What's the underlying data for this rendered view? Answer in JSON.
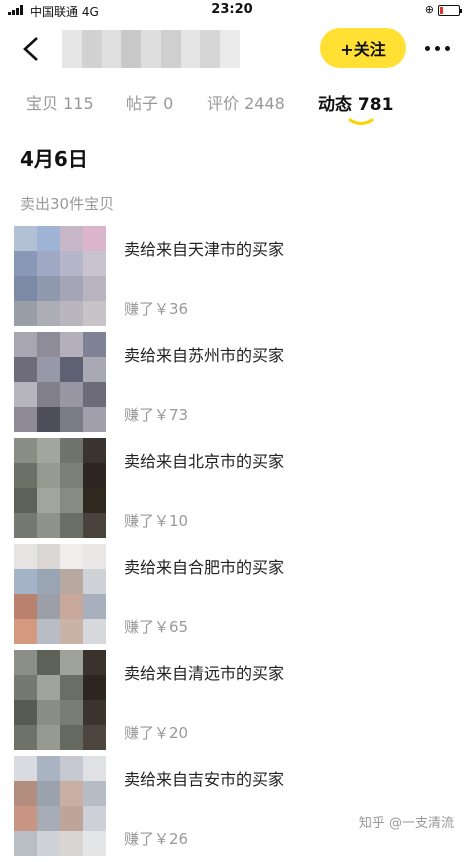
{
  "status_bar": {
    "carrier": "中国联通  4G",
    "time": "23:20",
    "lock_symbol": "⊕"
  },
  "header": {
    "follow_label": "+关注"
  },
  "tabs": [
    {
      "label": "宝贝 115"
    },
    {
      "label": "帖子 0"
    },
    {
      "label": "评价 2448"
    },
    {
      "label": "动态 781",
      "active": true
    }
  ],
  "feed": {
    "date": "4月6日",
    "subtitle": "卖出30件宝贝",
    "items": [
      {
        "desc": "卖给来自天津市的买家",
        "earn": "赚了￥36"
      },
      {
        "desc": "卖给来自苏州市的买家",
        "earn": "赚了￥73"
      },
      {
        "desc": "卖给来自北京市的买家",
        "earn": "赚了￥10"
      },
      {
        "desc": "卖给来自合肥市的买家",
        "earn": "赚了￥65"
      },
      {
        "desc": "卖给来自清远市的买家",
        "earn": "赚了￥20"
      },
      {
        "desc": "卖给来自吉安市的买家",
        "earn": "赚了￥26"
      }
    ]
  },
  "watermark": "知乎 @一支清流",
  "colors": {
    "accent_yellow": "#ffe033",
    "muted_text": "#999999",
    "battery_low": "#e0342a"
  }
}
